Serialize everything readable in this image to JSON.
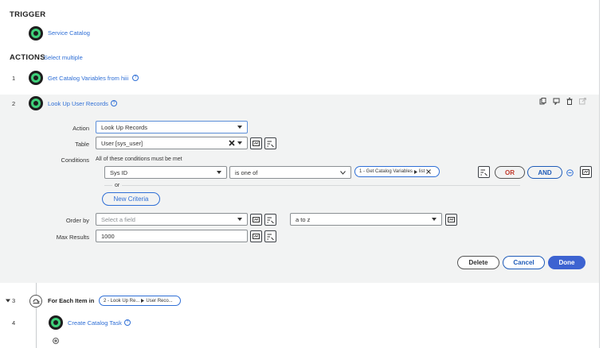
{
  "trigger": {
    "heading": "TRIGGER",
    "name": "Service Catalog"
  },
  "actions": {
    "heading": "ACTIONS",
    "select_multiple": "Select multiple",
    "steps": [
      {
        "number": "1",
        "label": "Get Catalog Variables from hiii"
      },
      {
        "number": "2",
        "label": "Look Up User Records"
      },
      {
        "number": "3",
        "label": "For Each Item in"
      },
      {
        "number": "4",
        "label": "Create Catalog Task"
      }
    ]
  },
  "editor": {
    "action_label": "Action",
    "action_value": "Look Up Records",
    "table_label": "Table",
    "table_value": "User [sys_user]",
    "conditions_label": "Conditions",
    "conditions_mode": "All of these conditions must be met",
    "condition_field": "Sys ID",
    "condition_operator": "is one of",
    "condition_pill_step": "1 - Get Catalog Variables",
    "condition_pill_field": "list",
    "or_text": "or",
    "or_button": "OR",
    "and_button": "AND",
    "new_criteria": "New Criteria",
    "order_by_label": "Order by",
    "order_by_placeholder": "Select a field",
    "order_direction": "a to z",
    "max_results_label": "Max Results",
    "max_results_value": "1000",
    "delete_button": "Delete",
    "cancel_button": "Cancel",
    "done_button": "Done"
  },
  "foreach_pill": {
    "step": "2 - Look Up Re...",
    "field": "User Reco..."
  },
  "colors": {
    "accent": "#2f6fd6",
    "node_green": "#3ed17a",
    "panel_bg": "#f2f3f3",
    "or_text": "#c0392b"
  }
}
